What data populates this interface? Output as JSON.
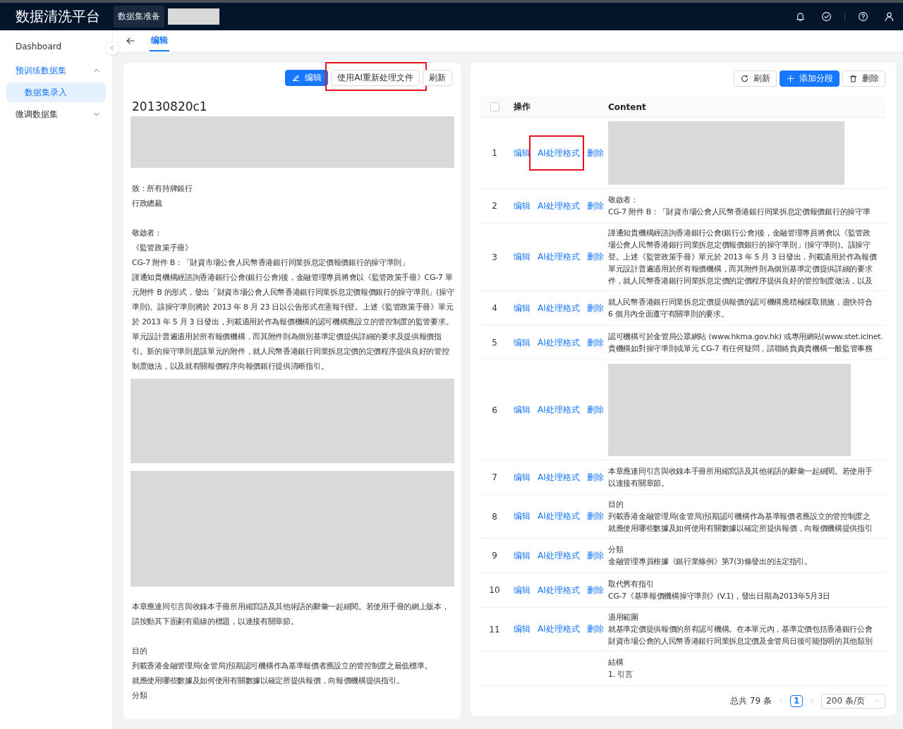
{
  "header": {
    "title": "数据清洗平台",
    "breadcrumb": [
      {
        "kind": "tag",
        "label": "数据集准备"
      },
      {
        "kind": "redacted"
      }
    ]
  },
  "sidebar": {
    "items": [
      {
        "label": "Dashboard",
        "selected": false
      },
      {
        "label": "预训练数据集",
        "selected": false,
        "expanded": true,
        "children": [
          {
            "label": "数据集录入",
            "selected": true
          }
        ]
      },
      {
        "label": "微调数据集",
        "selected": false,
        "expanded": false
      }
    ]
  },
  "tabs": [
    {
      "label": "编辑",
      "selected": true
    }
  ],
  "document": {
    "toolbar": [
      {
        "kind": "edit",
        "label": "编辑",
        "highlighted": false
      },
      {
        "kind": "plain",
        "label": "使用AI重新处理文件",
        "highlighted": true
      },
      {
        "kind": "plain",
        "label": "刷新",
        "highlighted": false
      }
    ],
    "title": "20130820c1",
    "blocks": [
      {
        "kind": "image"
      },
      {
        "kind": "text",
        "text": "致：所有持牌銀行"
      },
      {
        "kind": "text",
        "text": "行政總裁"
      },
      {
        "kind": "gap"
      },
      {
        "kind": "text",
        "text": "敬啟者："
      },
      {
        "kind": "text",
        "text": "《監管政策手冊》"
      },
      {
        "kind": "text",
        "text": "CG-7 附件 B：「財資市場公會人民幣香港銀行同業拆息定價報價銀行的操守準則」"
      },
      {
        "kind": "text",
        "text": "謹通知貴機構經諮詢香港銀行公會(銀行公會)後，金融管理專員將會以《監管政策手冊》CG-7 單元附件 B 的形式，發出「財資市場公會人民幣香港銀行同業拆息定價報價銀行的操守準則」(操守準則)。該操守準則將於 2013 年 8 月 23 日以公告形式在憲報刊登。上述《監管政策手冊》單元於 2013 年 5 月 3 日發出，列載適用於作為報價機構的認可機構應設立的管控制度的監管要求。單元設計普遍適用於所有報價機構，而其附件則為個別基準定價提供詳細的要求及提供報價指引。新的操守準則是該單元的附件，就人民幣香港銀行同業拆息定價的定價程序提供良好的管控制度做法，以及就有關報價程序向報價銀行提供清晰指引。"
      },
      {
        "kind": "large-image"
      },
      {
        "kind": "large-image"
      },
      {
        "kind": "text",
        "text": "本章應連同引言與收錄本手冊所用縮寫語及其他術語的辭彙一起細閱。若使用手冊的網上版本，請按動其下面劃有藍線的標題，以連接有關章節。"
      },
      {
        "kind": "gap"
      },
      {
        "kind": "text",
        "text": "目的"
      },
      {
        "kind": "text",
        "text": "列載香港金融管理局(金管局)預期認可機構作為基準報價者應設立的管控制度之最低標準。"
      },
      {
        "kind": "text",
        "text": "就應使用哪些數據及如何使用有關數據以確定所提供報價，向報價機構提供指引。"
      },
      {
        "kind": "text",
        "text": "分類"
      }
    ]
  },
  "segments": {
    "toolbar": [
      {
        "kind": "refresh",
        "label": "刷新"
      },
      {
        "kind": "add",
        "label": "添加分段"
      },
      {
        "kind": "delete",
        "label": "删除"
      }
    ],
    "select_all": {
      "checked": false
    },
    "columns": [
      "操作",
      "Content"
    ],
    "rows": [
      {
        "index": "1",
        "actions": [
          {
            "label": "编辑",
            "highlighted": false
          },
          {
            "label": "AI处理格式",
            "highlighted": true
          },
          {
            "label": "删除",
            "highlighted": false
          }
        ],
        "content": {
          "kind": "image"
        }
      },
      {
        "index": "2",
        "actions": [
          {
            "label": "编辑",
            "highlighted": false
          },
          {
            "label": "AI处理格式",
            "highlighted": false
          },
          {
            "label": "删除",
            "highlighted": false
          }
        ],
        "content": {
          "kind": "text",
          "lines": [
            "敬啟者：",
            "CG-7 附件 B：「財資市場公會人民幣香港銀行同業拆息定價報價銀行的操守準"
          ]
        }
      },
      {
        "index": "3",
        "actions": [
          {
            "label": "编辑",
            "highlighted": false
          },
          {
            "label": "AI处理格式",
            "highlighted": false
          },
          {
            "label": "删除",
            "highlighted": false
          }
        ],
        "content": {
          "kind": "text",
          "lines": [
            "謹通知貴機構經諮詢香港銀行公會(銀行公會)後，金融管理專員將會以《監管政",
            "場公會人民幣香港銀行同業拆息定價報價銀行的操守準則」(操守準則)。該操守",
            "登。上述《監管政策手冊》單元於 2013 年 5 月 3 日發出，列載適用於作為報價",
            "單元設計普遍適用於所有報價機構，而其附件則為個別基準定價提供詳細的要求",
            "件，就人民幣香港銀行同業拆息定價的定價程序提供良好的管控制度做法，以及"
          ]
        }
      },
      {
        "index": "4",
        "actions": [
          {
            "label": "编辑",
            "highlighted": false
          },
          {
            "label": "AI处理格式",
            "highlighted": false
          },
          {
            "label": "删除",
            "highlighted": false
          }
        ],
        "content": {
          "kind": "text",
          "lines": [
            "就人民幣香港銀行同業拆息定價提供報價的認可機構應積極採取措施，盡快符合",
            "6 個月內全面遵守有關準則的要求。"
          ]
        }
      },
      {
        "index": "5",
        "actions": [
          {
            "label": "编辑",
            "highlighted": false
          },
          {
            "label": "AI处理格式",
            "highlighted": false
          },
          {
            "label": "删除",
            "highlighted": false
          }
        ],
        "content": {
          "kind": "text",
          "lines": [
            "認可機構可於金管局公眾網站 (www.hkma.gov.hk) 或專用網站(www.stet.iclnet.",
            "貴機構如對操守準則或單元 CG-7 有任何疑問，請聯絡負責貴機構一般監管事務"
          ]
        }
      },
      {
        "index": "6",
        "actions": [
          {
            "label": "编辑",
            "highlighted": false
          },
          {
            "label": "AI处理格式",
            "highlighted": false
          },
          {
            "label": "删除",
            "highlighted": false
          }
        ],
        "content": {
          "kind": "large-image"
        }
      },
      {
        "index": "7",
        "actions": [
          {
            "label": "编辑",
            "highlighted": false
          },
          {
            "label": "AI处理格式",
            "highlighted": false
          },
          {
            "label": "删除",
            "highlighted": false
          }
        ],
        "content": {
          "kind": "text",
          "lines": [
            "本章應連同引言與收錄本手冊所用縮寫語及其他術語的辭彙一起細閱。若使用手",
            "以連接有關章節。"
          ]
        }
      },
      {
        "index": "8",
        "actions": [
          {
            "label": "编辑",
            "highlighted": false
          },
          {
            "label": "AI处理格式",
            "highlighted": false
          },
          {
            "label": "删除",
            "highlighted": false
          }
        ],
        "content": {
          "kind": "text",
          "lines": [
            "目的",
            "列載香港金融管理局(金管局)預期認可機構作為基準報價者應設立的管控制度之",
            "就應使用哪些數據及如何使用有關數據以確定所提供報價，向報價機構提供指引"
          ]
        }
      },
      {
        "index": "9",
        "actions": [
          {
            "label": "编辑",
            "highlighted": false
          },
          {
            "label": "AI处理格式",
            "highlighted": false
          },
          {
            "label": "删除",
            "highlighted": false
          }
        ],
        "content": {
          "kind": "text",
          "lines": [
            "分類",
            "金融管理專員根據《銀行業條例》第7(3)條發出的法定指引。"
          ]
        }
      },
      {
        "index": "10",
        "actions": [
          {
            "label": "编辑",
            "highlighted": false
          },
          {
            "label": "AI处理格式",
            "highlighted": false
          },
          {
            "label": "删除",
            "highlighted": false
          }
        ],
        "content": {
          "kind": "text",
          "lines": [
            "取代舊有指引",
            "CG-7《基準報價機構操守準則》(V.1)，發出日期為2013年5月3日"
          ]
        }
      },
      {
        "index": "11",
        "actions": [
          {
            "label": "编辑",
            "highlighted": false
          },
          {
            "label": "AI处理格式",
            "highlighted": false
          },
          {
            "label": "删除",
            "highlighted": false
          }
        ],
        "content": {
          "kind": "text",
          "lines": [
            "適用範圍",
            "就基準定價提供報價的所有認可機構。在本單元內，基準定價包括香港銀行公會",
            "財資市場公會的人民幣香港銀行同業拆息定價及金管局日後可能指明的其他類別"
          ]
        }
      },
      {
        "content": {
          "kind": "text",
          "lines": [
            "結構",
            "1. 引言"
          ]
        }
      }
    ],
    "pagination": {
      "total": "总共 79 条",
      "pages": [
        {
          "label": "1",
          "selected": true
        }
      ],
      "page_size": "200 条/页"
    }
  }
}
